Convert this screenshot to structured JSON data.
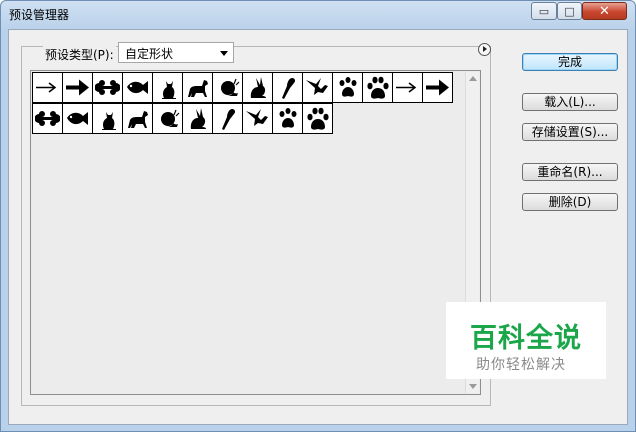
{
  "window": {
    "title": "预设管理器",
    "controls": {
      "minimize": "▭",
      "maximize": "□",
      "close": "✕"
    }
  },
  "preset": {
    "type_label": "预设类型(P):",
    "type_value": "自定形状"
  },
  "shapes": [
    [
      "arrow-thin",
      "arrow-bold",
      "bone",
      "fish",
      "cat",
      "dog",
      "snail",
      "rabbit",
      "parrot",
      "bird",
      "paw-print",
      "paw",
      "arrow-thin",
      "arrow-bold"
    ],
    [
      "bone",
      "fish",
      "cat",
      "dog",
      "snail",
      "rabbit",
      "parrot",
      "bird",
      "paw-print",
      "paw"
    ]
  ],
  "buttons": {
    "done": "完成",
    "load": "载入(L)...",
    "save": "存储设置(S)...",
    "rename": "重命名(R)...",
    "delete": "删除(D)"
  },
  "watermark": {
    "title": "百科全说",
    "subtitle": "助你轻松解决"
  },
  "colors": {
    "accent_green": "#1ca64a",
    "title_bar": "#b9d1ea"
  }
}
